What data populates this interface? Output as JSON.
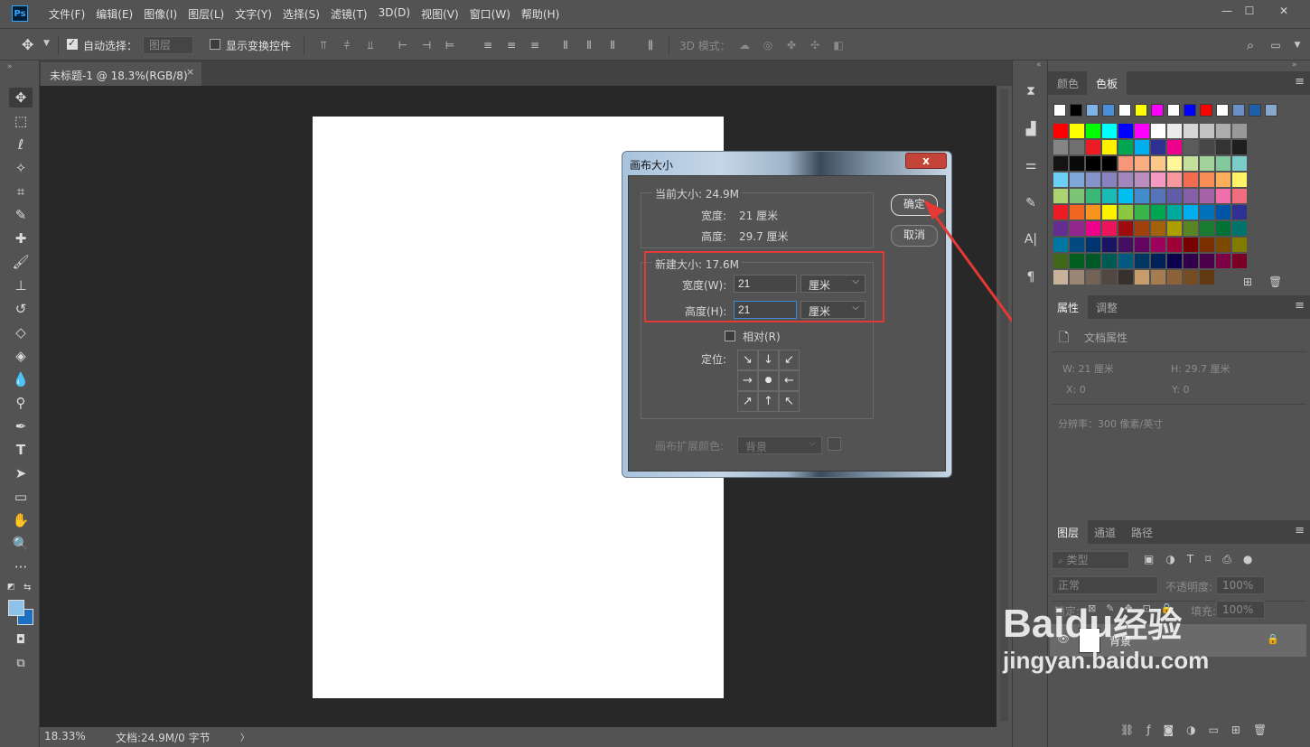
{
  "app": {
    "logo": "Ps"
  },
  "menu": [
    "文件(F)",
    "编辑(E)",
    "图像(I)",
    "图层(L)",
    "文字(Y)",
    "选择(S)",
    "滤镜(T)",
    "3D(D)",
    "视图(V)",
    "窗口(W)",
    "帮助(H)"
  ],
  "window_controls": [
    "minimize-icon",
    "maximize-icon",
    "close-icon"
  ],
  "options": {
    "auto_select_label": "自动选择：",
    "auto_select_checked": true,
    "auto_select_value": "图层",
    "show_transform_label": "显示变换控件",
    "mode_3d_label": "3D 模式："
  },
  "document": {
    "tab_title": "未标题-1 @ 18.3%(RGB/8)",
    "tab_close": "×",
    "zoom": "18.33%",
    "doc_info": "文档:24.9M/0 字节",
    "status_arrow": "〉"
  },
  "dialog": {
    "title": "画布大小",
    "close": "x",
    "current_size_label": "当前大小: 24.9M",
    "current_width_label": "宽度:",
    "current_width_value": "21 厘米",
    "current_height_label": "高度:",
    "current_height_value": "29.7 厘米",
    "new_size_label": "新建大小: 17.6M",
    "width_label": "宽度(W):",
    "width_value": "21",
    "width_unit": "厘米",
    "height_label": "高度(H):",
    "height_value": "21",
    "height_unit": "厘米",
    "relative_label": "相对(R)",
    "relative_checked": false,
    "anchor_label": "定位:",
    "anchor_grid": [
      "↘",
      "↓",
      "↙",
      "→",
      "●",
      "←",
      "↗",
      "↑",
      "↖"
    ],
    "extension_color_label": "画布扩展颜色:",
    "extension_color_value": "背景",
    "ok_label": "确定",
    "cancel_label": "取消"
  },
  "swatches_panel": {
    "tabs": [
      "颜色",
      "色板"
    ],
    "active_tab": "色板",
    "recent": [
      "#ffffff",
      "#000000",
      "#7fb2e8",
      "#4a8fd9",
      "#ffffff",
      "#ffff00",
      "#ff00ff",
      "#ffffff",
      "#0000ff",
      "#ff0000",
      "#ffffff",
      "#6b8fc7",
      "#1d5fa8",
      "#88a7cc"
    ],
    "rows": [
      [
        "#ff0000",
        "#ffff00",
        "#00ff00",
        "#00ffff",
        "#0000ff",
        "#ff00ff",
        "#ffffff",
        "#ebebeb",
        "#d6d6d6",
        "#c2c2c2",
        "#adadad",
        "#999999"
      ],
      [
        "#858585",
        "#707070",
        "#ed1c24",
        "#fff200",
        "#00a651",
        "#00aeef",
        "#2e3192",
        "#ec008c",
        "#5c5c5c",
        "#474747",
        "#333333",
        "#1f1f1f"
      ],
      [
        "#141414",
        "#0a0a0a",
        "#000000",
        "#000000",
        "#f7977a",
        "#f9ad81",
        "#fdc68a",
        "#fff79a",
        "#c4df9b",
        "#a2d39c",
        "#82ca9d",
        "#7bcdc8"
      ],
      [
        "#6ecff6",
        "#7ea7d8",
        "#8493ca",
        "#8882be",
        "#a187be",
        "#bc8dbf",
        "#f49ac2",
        "#f6989d",
        "#f26c4f",
        "#f68e55",
        "#fbaf5c",
        "#fff467"
      ],
      [
        "#acd372",
        "#7cc576",
        "#3bb878",
        "#1abbb4",
        "#00bff3",
        "#438ccb",
        "#5574b9",
        "#605ca8",
        "#855fa8",
        "#a763a8",
        "#f06ea9",
        "#f26d7d"
      ],
      [
        "#ed1c24",
        "#f26522",
        "#f7941d",
        "#fff200",
        "#8dc73f",
        "#39b54a",
        "#00a651",
        "#00a99d",
        "#00aeef",
        "#0072bc",
        "#0054a6",
        "#2e3192"
      ],
      [
        "#662d91",
        "#92278f",
        "#ec008c",
        "#ed145b",
        "#9e0b0f",
        "#a0410d",
        "#a3620a",
        "#aba000",
        "#598527",
        "#197b30",
        "#007236",
        "#00746b"
      ],
      [
        "#0076a3",
        "#004a80",
        "#003471",
        "#1b1464",
        "#440e62",
        "#630460",
        "#9e005d",
        "#9e0039",
        "#790000",
        "#7b2e00",
        "#7d4900",
        "#827b00"
      ],
      [
        "#406618",
        "#005e20",
        "#005826",
        "#005952",
        "#005b7f",
        "#003663",
        "#002157",
        "#0d004c",
        "#32004b",
        "#4b0049",
        "#7b0046",
        "#7a0026"
      ],
      [
        "#c7b299",
        "#998675",
        "#736357",
        "#534741",
        "#37302d",
        "#c69c6d",
        "#a67c52",
        "#8c6239",
        "#754c24",
        "#603913"
      ]
    ]
  },
  "properties_panel": {
    "tabs": [
      "属性",
      "调整"
    ],
    "active_tab": "属性",
    "header": "文档属性",
    "w_label": "W:",
    "w_value": "21 厘米",
    "h_label": "H:",
    "h_value": "29.7 厘米",
    "x_label": "X:",
    "x_value": "0",
    "y_label": "Y:",
    "y_value": "0",
    "resolution": "分辨率：300 像素/英寸"
  },
  "layers_panel": {
    "tabs": [
      "图层",
      "通道",
      "路径"
    ],
    "active_tab": "图层",
    "filter_placeholder": "类型",
    "blend_mode": "正常",
    "opacity_label": "不透明度:",
    "opacity_value": "100%",
    "lock_label": "锁定:",
    "fill_label": "填充:",
    "fill_value": "100%",
    "layer_name": "背景"
  },
  "watermark": {
    "brand": "Baidu",
    "brand_cn": "经验",
    "url": "jingyan.baidu.com"
  }
}
